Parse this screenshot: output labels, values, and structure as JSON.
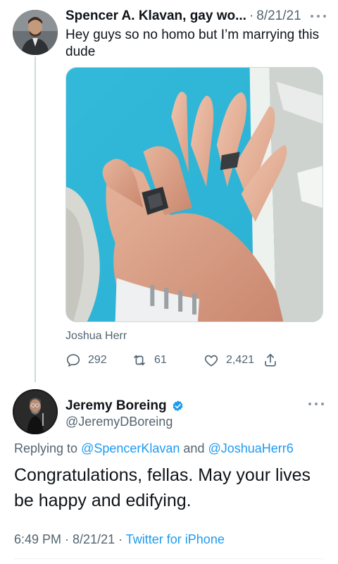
{
  "parent_tweet": {
    "author_name": "Spencer A. Klavan, gay wo...",
    "separator": "·",
    "date": "8/21/21",
    "text": "Hey guys so no homo but I’m marrying this dude",
    "media_credit": "Joshua Herr",
    "actions": {
      "replies": "292",
      "retweets": "61",
      "likes": "2,421"
    }
  },
  "reply_tweet": {
    "author_name": "Jeremy Boreing",
    "author_handle": "@JeremyDBoreing",
    "replying_prefix": "Replying to ",
    "mention_1": "@SpencerKlavan",
    "mention_joiner": " and ",
    "mention_2": "@JoshuaHerr6",
    "text": "Congratulations, fellas. May your lives be happy and edifying.",
    "time": "6:49 PM",
    "date": "8/21/21",
    "separator": " · ",
    "source": "Twitter for iPhone"
  },
  "colors": {
    "accent": "#1d9bf0",
    "secondary_text": "#536471",
    "primary_text": "#0f1419"
  },
  "icons": [
    "more-icon",
    "reply-icon",
    "retweet-icon",
    "like-icon",
    "share-icon",
    "verified-icon"
  ]
}
